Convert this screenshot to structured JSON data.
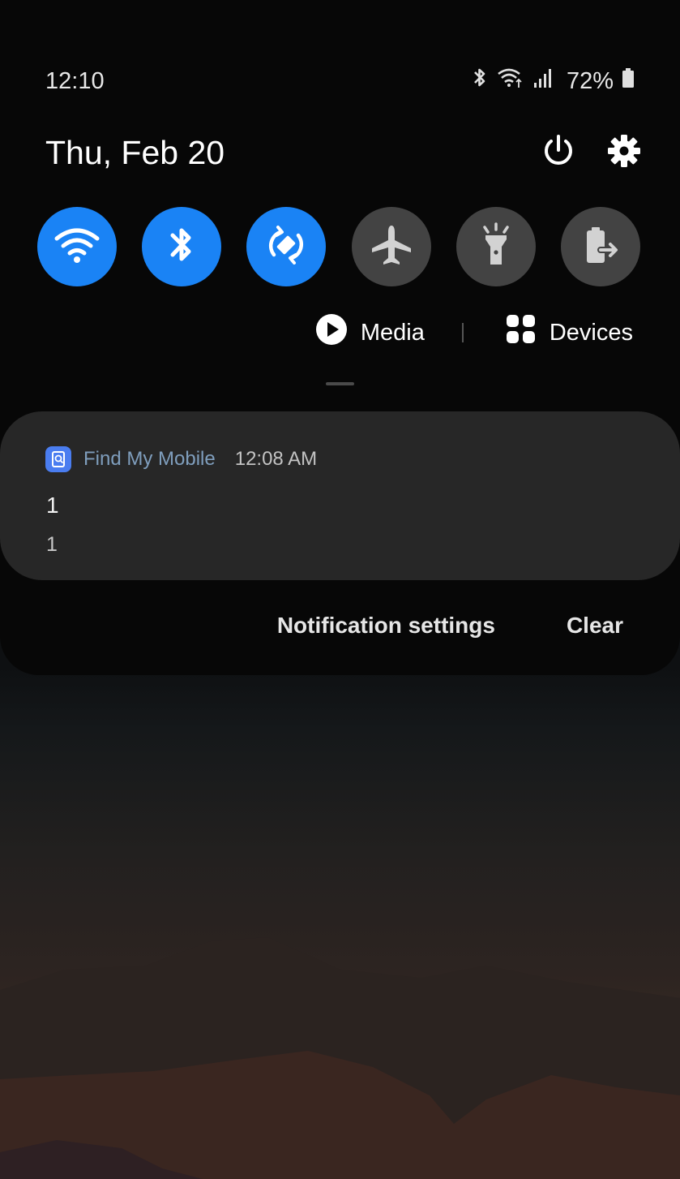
{
  "status_bar": {
    "time": "12:10",
    "battery_percent": "72%",
    "icons": [
      "bluetooth-icon",
      "wifi-icon",
      "signal-icon",
      "battery-icon"
    ]
  },
  "header": {
    "date": "Thu, Feb 20",
    "icons": [
      "power-icon",
      "settings-icon"
    ]
  },
  "quick_settings": [
    {
      "id": "wifi",
      "icon": "wifi-icon",
      "state": "on"
    },
    {
      "id": "bluetooth",
      "icon": "bluetooth-icon",
      "state": "on"
    },
    {
      "id": "auto-rotate",
      "icon": "auto-rotate-icon",
      "state": "on"
    },
    {
      "id": "airplane",
      "icon": "airplane-icon",
      "state": "off"
    },
    {
      "id": "flashlight",
      "icon": "flashlight-icon",
      "state": "off"
    },
    {
      "id": "secure-folder",
      "icon": "secure-folder-icon",
      "state": "off"
    }
  ],
  "media_bar": {
    "media_label": "Media",
    "devices_label": "Devices"
  },
  "notification": {
    "app_name": "Find My Mobile",
    "time": "12:08 AM",
    "title": "1",
    "text": "1"
  },
  "actions": {
    "settings_label": "Notification settings",
    "clear_label": "Clear"
  },
  "colors": {
    "accent": "#1a83f5",
    "toggle_off": "#434343",
    "card_bg": "#272727",
    "shade_bg": "#070707"
  }
}
